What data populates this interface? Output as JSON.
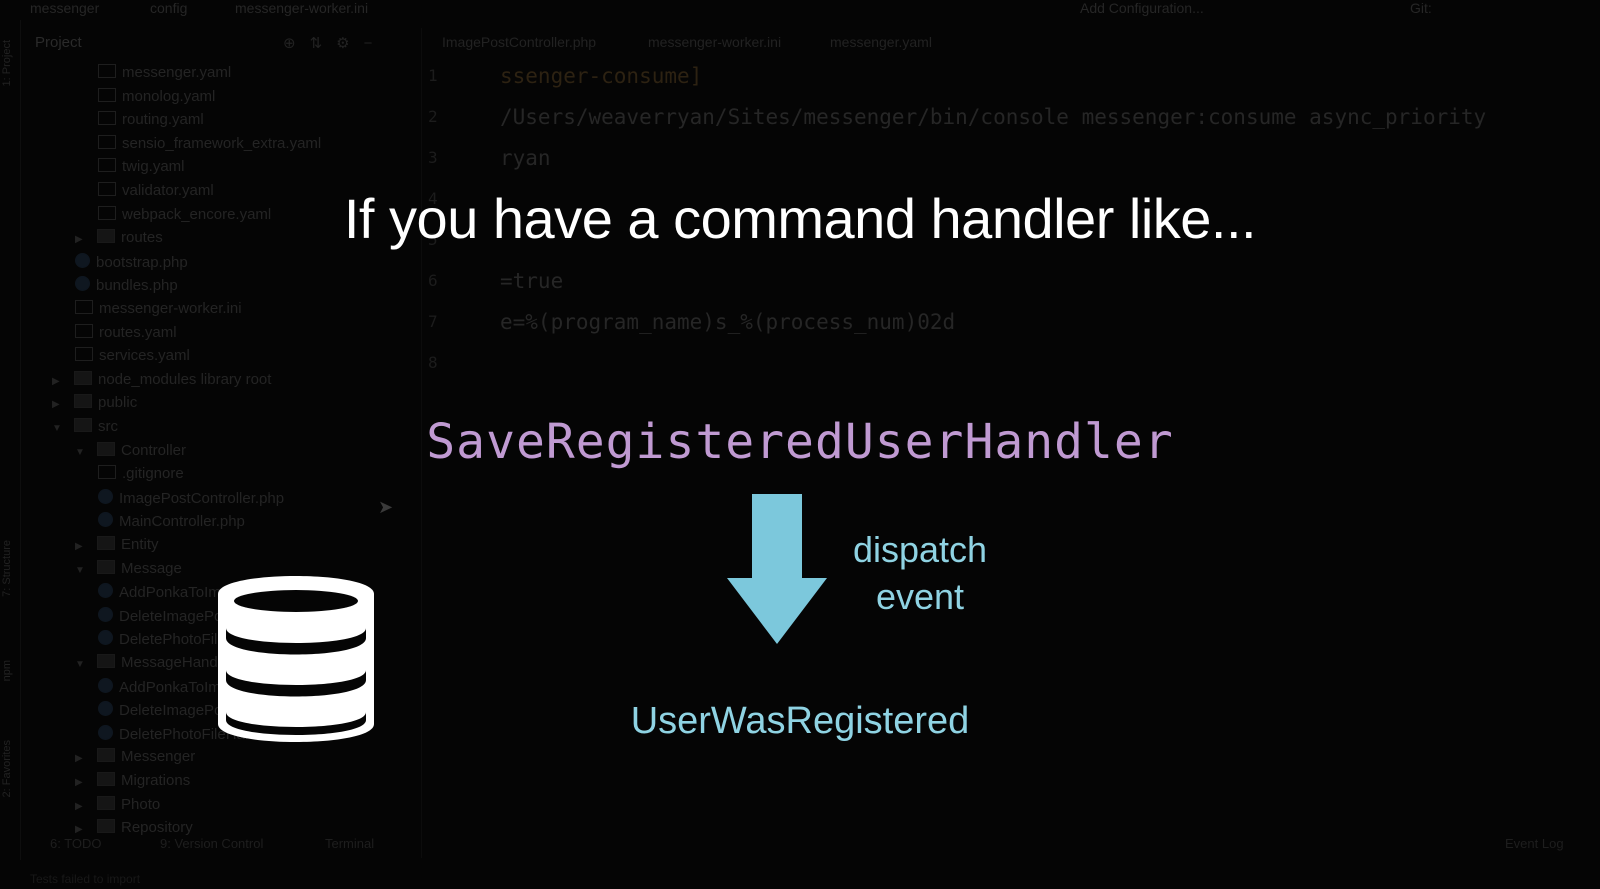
{
  "ide": {
    "title_segments": [
      "messenger",
      "config",
      "messenger-worker.ini"
    ],
    "run_config": "Add Configuration...",
    "vcs_label": "Git:",
    "left_strip_tabs": [
      "1: Project",
      "7: Structure",
      "npm",
      "2: Favorites"
    ],
    "project_panel_title": "Project",
    "tree": [
      {
        "label": "messenger.yaml",
        "indent": 3,
        "type": "yaml"
      },
      {
        "label": "monolog.yaml",
        "indent": 3,
        "type": "yaml"
      },
      {
        "label": "routing.yaml",
        "indent": 3,
        "type": "yaml"
      },
      {
        "label": "sensio_framework_extra.yaml",
        "indent": 3,
        "type": "yaml"
      },
      {
        "label": "twig.yaml",
        "indent": 3,
        "type": "yaml"
      },
      {
        "label": "validator.yaml",
        "indent": 3,
        "type": "yaml"
      },
      {
        "label": "webpack_encore.yaml",
        "indent": 3,
        "type": "yaml"
      },
      {
        "label": "routes",
        "indent": 2,
        "type": "folder",
        "arrow": "▶"
      },
      {
        "label": "bootstrap.php",
        "indent": 2,
        "type": "php"
      },
      {
        "label": "bundles.php",
        "indent": 2,
        "type": "php"
      },
      {
        "label": "messenger-worker.ini",
        "indent": 2,
        "type": "ini"
      },
      {
        "label": "routes.yaml",
        "indent": 2,
        "type": "yaml"
      },
      {
        "label": "services.yaml",
        "indent": 2,
        "type": "yaml"
      },
      {
        "label": "node_modules  library root",
        "indent": 1,
        "type": "folder",
        "arrow": "▶"
      },
      {
        "label": "public",
        "indent": 1,
        "type": "folder",
        "arrow": "▶"
      },
      {
        "label": "src",
        "indent": 1,
        "type": "folder",
        "arrow": "▼"
      },
      {
        "label": "Controller",
        "indent": 2,
        "type": "folder",
        "arrow": "▼"
      },
      {
        "label": ".gitignore",
        "indent": 3,
        "type": "git"
      },
      {
        "label": "ImagePostController.php",
        "indent": 3,
        "type": "php"
      },
      {
        "label": "MainController.php",
        "indent": 3,
        "type": "php"
      },
      {
        "label": "Entity",
        "indent": 2,
        "type": "folder",
        "arrow": "▶"
      },
      {
        "label": "Message",
        "indent": 2,
        "type": "folder",
        "arrow": "▼"
      },
      {
        "label": "AddPonkaToImage.php",
        "indent": 3,
        "type": "php"
      },
      {
        "label": "DeleteImagePost.php",
        "indent": 3,
        "type": "php"
      },
      {
        "label": "DeletePhotoFile.php",
        "indent": 3,
        "type": "php"
      },
      {
        "label": "MessageHandler",
        "indent": 2,
        "type": "folder",
        "arrow": "▼"
      },
      {
        "label": "AddPonkaToImageHandler.php",
        "indent": 3,
        "type": "php"
      },
      {
        "label": "DeleteImagePostHandler.php",
        "indent": 3,
        "type": "php"
      },
      {
        "label": "DeletePhotoFileHandler.php",
        "indent": 3,
        "type": "php"
      },
      {
        "label": "Messenger",
        "indent": 2,
        "type": "folder",
        "arrow": "▶"
      },
      {
        "label": "Migrations",
        "indent": 2,
        "type": "folder",
        "arrow": "▶"
      },
      {
        "label": "Photo",
        "indent": 2,
        "type": "folder",
        "arrow": "▶"
      },
      {
        "label": "Repository",
        "indent": 2,
        "type": "folder",
        "arrow": "▶"
      }
    ],
    "editor_tabs": [
      "ImagePostController.php",
      "messenger-worker.ini",
      "messenger.yaml"
    ],
    "gutter_numbers": [
      "1",
      "2",
      "3",
      "4",
      "5",
      "6",
      "7",
      "8"
    ],
    "code_lines": [
      "ssenger-consume]",
      "/Users/weaverryan/Sites/messenger/bin/console messenger:consume async_priority",
      "ryan",
      "",
      "",
      "=true",
      "e=%(program_name)s_%(process_num)02d",
      ""
    ],
    "status_left": [
      "6: TODO",
      "9: Version Control",
      "Terminal"
    ],
    "status_right": "Event Log",
    "bottom_text": "Tests failed to import"
  },
  "slide": {
    "title": "If you have a command handler like...",
    "handler_name": "SaveRegisteredUserHandler",
    "arrow_label_line1": "dispatch",
    "arrow_label_line2": "event",
    "event_name": "UserWasRegistered",
    "colors": {
      "title": "#ffffff",
      "handler": "#c09ad2",
      "event": "#8fd3e3",
      "arrow": "#7cc8dc",
      "database": "#ffffff"
    },
    "icons": [
      "down-arrow-icon",
      "database-icon"
    ]
  }
}
